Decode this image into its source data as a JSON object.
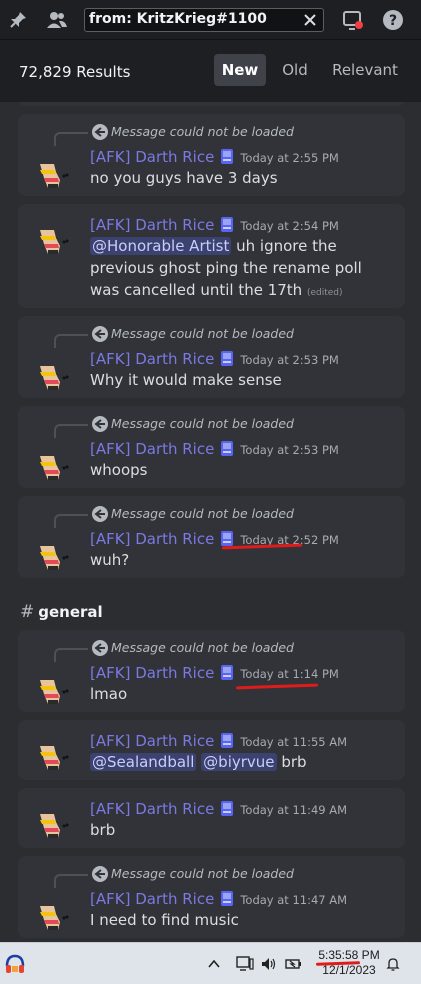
{
  "search": {
    "query": "from: KritzKrieg#1100"
  },
  "results": {
    "count_label": "72,829 Results",
    "sort_tabs": [
      {
        "label": "New",
        "active": true
      },
      {
        "label": "Old",
        "active": false
      },
      {
        "label": "Relevant",
        "active": false
      }
    ]
  },
  "reply_notice": "Message could not be loaded",
  "channel": {
    "name": "general"
  },
  "messages": [
    {
      "author": "[AFK] Darth Rice",
      "time": "Today at 2:55 PM",
      "text": "no you guys have 3 days",
      "reply": true
    },
    {
      "author": "[AFK] Darth Rice",
      "time": "Today at 2:54 PM",
      "mention": "@Honorable Artist",
      "text": " uh ignore the previous ghost ping the rename poll was cancelled until the 17th",
      "edited": "(edited)",
      "reply": false
    },
    {
      "author": "[AFK] Darth Rice",
      "time": "Today at 2:53 PM",
      "text": "Why it would make sense",
      "reply": true
    },
    {
      "author": "[AFK] Darth Rice",
      "time": "Today at 2:53 PM",
      "text": "whoops",
      "reply": true
    },
    {
      "author": "[AFK] Darth Rice",
      "time": "Today at 2:52 PM",
      "text": "wuh?",
      "reply": true
    },
    {
      "author": "[AFK] Darth Rice",
      "time": "Today at 1:14 PM",
      "text": "lmao",
      "reply": true
    },
    {
      "author": "[AFK] Darth Rice",
      "time": "Today at 11:55 AM",
      "mentions": [
        "@Sealandball",
        "@biyrvue"
      ],
      "text": "brb",
      "reply": false
    },
    {
      "author": "[AFK] Darth Rice",
      "time": "Today at 11:49 AM",
      "text": "brb",
      "reply": false
    },
    {
      "author": "[AFK] Darth Rice",
      "time": "Today at 11:47 AM",
      "text": "I need to find music",
      "reply": true
    }
  ],
  "taskbar": {
    "time": "5:35:58 PM",
    "date": "12/1/2023"
  },
  "colors": {
    "username": "#7b79e2",
    "mention_bg": "#3c4270",
    "annotation_red": "#e01b1b",
    "badge": "#5865f2"
  },
  "icons": [
    "pin-icon",
    "members-icon",
    "close-icon",
    "inbox-icon",
    "help-icon",
    "reply-arrow-icon",
    "headphones-icon",
    "chevron-up-icon",
    "display-icon",
    "speaker-icon",
    "battery-icon",
    "bell-icon"
  ]
}
